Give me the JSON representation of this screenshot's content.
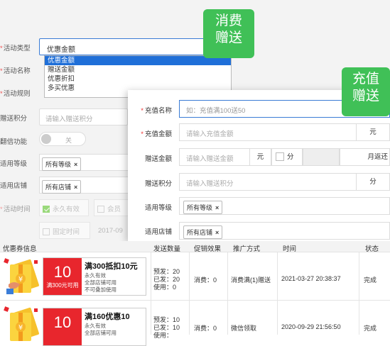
{
  "badges": {
    "panel1": "消费\n赠送",
    "panel2": "充值\n赠送",
    "color": "#40c057"
  },
  "bg_form": {
    "labels": {
      "activity_type": "活动类型",
      "activity_name": "活动名称",
      "activity_rule": "活动规则",
      "gift_points": "赠送积分",
      "double_func": "翻倍功能",
      "level": "适用等级",
      "store": "适用店铺",
      "activity_time": "活动时间"
    },
    "activity_type_value": "优惠金额",
    "dropdown_options": [
      "优惠金额",
      "赠送金额",
      "优惠折扣",
      "多买优惠"
    ],
    "gift_points_placeholder": "请输入赠送积分",
    "toggle_label": "关",
    "level_tag": "所有等级",
    "store_tag": "所有店铺",
    "permanent_label": "永久有效",
    "member_label": "会员",
    "fixed_time_label": "固定时间",
    "date_fragment": "2017-09"
  },
  "modal": {
    "labels": {
      "name": "充值名称",
      "amount": "充值金额",
      "gift_amount": "赠送金额",
      "gift_points": "赠送积分",
      "level": "适用等级",
      "store": "适用店铺"
    },
    "name_placeholder": "如：充值满100送50",
    "amount_placeholder": "请输入充值金额",
    "amount_unit": "元",
    "gift_amount_placeholder": "请输入赠送金额",
    "gift_amount_unit": "元",
    "split_label": "分",
    "monthly_return": "月返还",
    "gift_points_placeholder": "请输入赠送积分",
    "gift_points_unit": "分",
    "level_tag": "所有等级",
    "store_tag": "所有店铺"
  },
  "table": {
    "headers": [
      "优惠券信息",
      "发送数量",
      "促销效果",
      "推广方式",
      "时间",
      "状态"
    ],
    "rows": [
      {
        "coupon_value": "10",
        "coupon_condition": "满300元可用",
        "title": "满300抵扣10元",
        "validity": "永久有效",
        "stores": "全部店铺可用",
        "stack": "不可叠加使用",
        "presend": "预发：20",
        "sent": "已发：20",
        "used": "使用：0",
        "effect": "消费：0",
        "promo": "消费满(1)赠送",
        "time": "2021-03-27 20:38:37",
        "status": "完成"
      },
      {
        "coupon_value": "10",
        "title": "满160优惠10",
        "validity": "永久有效",
        "stores": "全部店铺可用",
        "presend": "预发：10",
        "sent": "已发：10",
        "used": "使用：",
        "effect": "消费：0",
        "promo": "微信领取",
        "time": "2020-09-29 21:56:50",
        "status": "完成"
      }
    ]
  }
}
